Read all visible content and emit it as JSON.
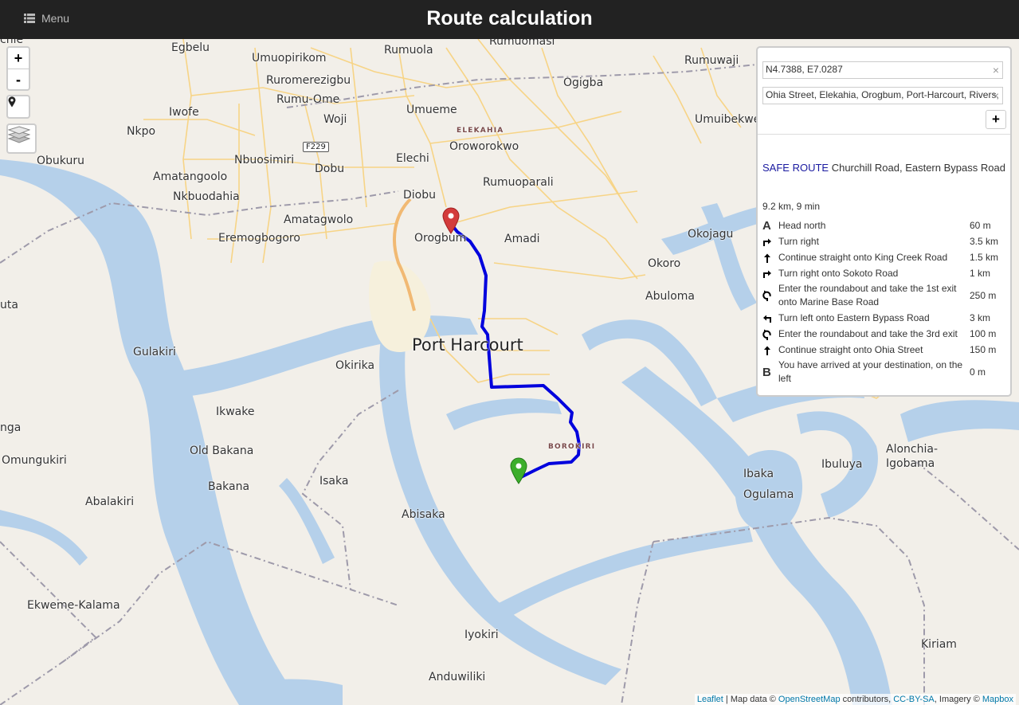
{
  "header": {
    "menu_label": "Menu",
    "title": "Route calculation"
  },
  "map": {
    "labels": [
      "Egbelu",
      "Rumuola",
      "Rumuomasi",
      "Rumuwaji",
      "Umuopirikom",
      "Ruromerezigbu",
      "Ogigba",
      "Rumu-Ome",
      "Iwofe",
      "Umueme",
      "Umuibekwe",
      "Nkpo",
      "Woji",
      "Obukuru",
      "Nbuosimiri",
      "Dobu",
      "Elechi",
      "Oroworokwo",
      "Amatangoolo",
      "Nkbuodahia",
      "Rumuoparali",
      "Diobu",
      "Okojagu",
      "Amatagwolo",
      "Eremogbogoro",
      "Orogbum",
      "Amadi",
      "Okoro",
      "Abuloma",
      "Port Harcourt",
      "Gulakiri",
      "Okirika",
      "Ikwake",
      "Old Bakana",
      "Omungukiri",
      "Bakana",
      "Isaka",
      "Abalakiri",
      "Abisaka",
      "Ibaka",
      "Ibuluya",
      "Alonchia-Igobama",
      "Ogulama",
      "Ekweme-Kalama",
      "Iyokiri",
      "Kiriam",
      "Anduwiliki",
      "uta",
      "nga",
      "chie"
    ],
    "districts": [
      "ELEKAHIA",
      "BOROKIRI"
    ],
    "road_shield": "F229",
    "route_color": "#0000dd"
  },
  "controls": {
    "zoom_in": "+",
    "zoom_out": "-"
  },
  "routing": {
    "waypoints": [
      {
        "value": "N4.7388, E7.0287",
        "clear": "×"
      },
      {
        "value": "Ohia Street, Elekahia, Orogbum, Port-Harcourt, Rivers, Nigeria",
        "clear": "×"
      }
    ],
    "add_waypoint": "+",
    "route_label": "SAFE ROUTE",
    "route_via": "Churchill Road, Eastern Bypass Road",
    "summary": "9.2 km, 9 min",
    "instructions": [
      {
        "icon": "depart-icon",
        "glyph": "A",
        "text": "Head north",
        "distance": "60 m"
      },
      {
        "icon": "turn-right-icon",
        "glyph": "",
        "text": "Turn right",
        "distance": "3.5 km"
      },
      {
        "icon": "straight-icon",
        "glyph": "",
        "text": "Continue straight onto King Creek Road",
        "distance": "1.5 km"
      },
      {
        "icon": "turn-right-icon",
        "glyph": "",
        "text": "Turn right onto Sokoto Road",
        "distance": "1 km"
      },
      {
        "icon": "roundabout-icon",
        "glyph": "",
        "text": "Enter the roundabout and take the 1st exit onto Marine Base Road",
        "distance": "250 m"
      },
      {
        "icon": "turn-left-icon",
        "glyph": "",
        "text": "Turn left onto Eastern Bypass Road",
        "distance": "3 km"
      },
      {
        "icon": "roundabout-icon",
        "glyph": "",
        "text": "Enter the roundabout and take the 3rd exit",
        "distance": "100 m"
      },
      {
        "icon": "straight-icon",
        "glyph": "",
        "text": "Continue straight onto Ohia Street",
        "distance": "150 m"
      },
      {
        "icon": "arrive-icon",
        "glyph": "B",
        "text": "You have arrived at your destination, on the left",
        "distance": "0 m"
      }
    ]
  },
  "attribution": {
    "leaflet": "Leaflet",
    "sep1": " | Map data © ",
    "osm": "OpenStreetMap",
    "contributors": " contributors, ",
    "license": "CC-BY-SA",
    "imagery": ", Imagery © ",
    "mapbox": "Mapbox"
  }
}
